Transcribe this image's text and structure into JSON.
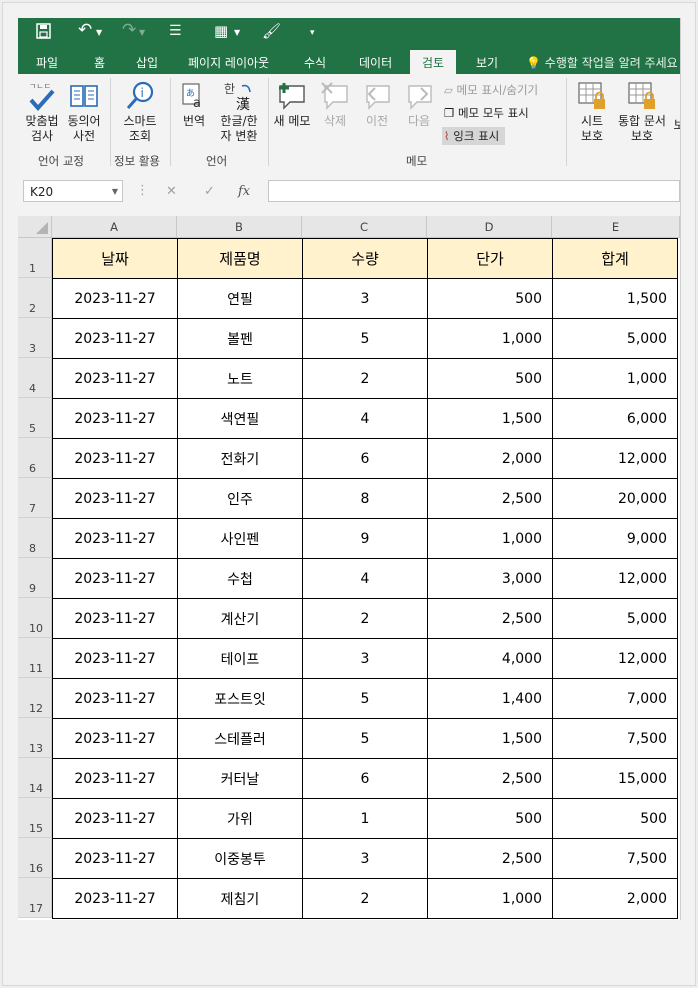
{
  "qat": {
    "save_icon": "save-icon",
    "undo_icon": "undo-icon",
    "redo_icon": "redo-icon",
    "customize_icon": "customize-icon"
  },
  "tabs": [
    "파일",
    "홈",
    "삽입",
    "페이지 레이아웃",
    "수식",
    "데이터",
    "검토",
    "보기"
  ],
  "active_tab": "검토",
  "tell_me": "수행할 작업을 알려 주세요",
  "ribbon": {
    "spelling": "맞춤법\n검사",
    "thesaurus": "동의어\n사전",
    "group_proofing": "언어 교정",
    "smart_lookup": "스마트\n조회",
    "group_insights": "정보 활용",
    "translate": "번역",
    "hangul_hanja": "한글/한\n자 변환",
    "group_language": "언어",
    "new_comment": "새 메모",
    "delete": "삭제",
    "previous": "이전",
    "next": "다음",
    "show_hide_comment": "메모 표시/숨기기",
    "show_all_comments": "메모 모두 표시",
    "show_ink": "잉크 표시",
    "group_comments": "메모",
    "protect_sheet": "시트\n보호",
    "protect_workbook": "통합 문서\n보호",
    "protect_shared": "보"
  },
  "name_box": "K20",
  "formula_value": "",
  "columns": [
    "A",
    "B",
    "C",
    "D",
    "E"
  ],
  "row_numbers": [
    "1",
    "2",
    "3",
    "4",
    "5",
    "6",
    "7",
    "8",
    "9",
    "10",
    "11",
    "12",
    "13",
    "14",
    "15",
    "16",
    "17"
  ],
  "headers": [
    "날짜",
    "제품명",
    "수량",
    "단가",
    "합계"
  ],
  "rows": [
    [
      "2023-11-27",
      "연필",
      "3",
      "500",
      "1,500"
    ],
    [
      "2023-11-27",
      "볼펜",
      "5",
      "1,000",
      "5,000"
    ],
    [
      "2023-11-27",
      "노트",
      "2",
      "500",
      "1,000"
    ],
    [
      "2023-11-27",
      "색연필",
      "4",
      "1,500",
      "6,000"
    ],
    [
      "2023-11-27",
      "전화기",
      "6",
      "2,000",
      "12,000"
    ],
    [
      "2023-11-27",
      "인주",
      "8",
      "2,500",
      "20,000"
    ],
    [
      "2023-11-27",
      "사인펜",
      "9",
      "1,000",
      "9,000"
    ],
    [
      "2023-11-27",
      "수첩",
      "4",
      "3,000",
      "12,000"
    ],
    [
      "2023-11-27",
      "계산기",
      "2",
      "2,500",
      "5,000"
    ],
    [
      "2023-11-27",
      "테이프",
      "3",
      "4,000",
      "12,000"
    ],
    [
      "2023-11-27",
      "포스트잇",
      "5",
      "1,400",
      "7,000"
    ],
    [
      "2023-11-27",
      "스테플러",
      "5",
      "1,500",
      "7,500"
    ],
    [
      "2023-11-27",
      "커터날",
      "6",
      "2,500",
      "15,000"
    ],
    [
      "2023-11-27",
      "가위",
      "1",
      "500",
      "500"
    ],
    [
      "2023-11-27",
      "이중봉투",
      "3",
      "2,500",
      "7,500"
    ],
    [
      "2023-11-27",
      "제침기",
      "2",
      "1,000",
      "2,000"
    ]
  ],
  "colors": {
    "excel_green": "#217346",
    "header_fill": "#fff2cc"
  }
}
